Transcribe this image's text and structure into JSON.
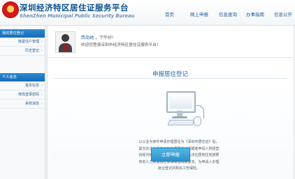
{
  "header": {
    "title_cn": "深圳经济特区居住证服务平台",
    "title_en": "ShenZhen Municipal Public Security Bureau",
    "nav": [
      "首页",
      "网上申报",
      "信息查询",
      "办事指南",
      "信息公开"
    ]
  },
  "sidebar": {
    "group1_title": "我的居住登记",
    "group1_items": [
      "房屋住户管理",
      "历史登记"
    ],
    "group2_title": "个人信息",
    "group2_items": [
      "基本信息",
      "修改登录密码",
      "系统消息"
    ]
  },
  "welcome": {
    "user_name": "西岛她",
    "greeting": "，下午好!",
    "message": "欢迎您登录深圳市经济特区居住证服务平台！"
  },
  "main": {
    "section_title": "申报居住登记",
    "notice": "以以业为条件申请办理居住为《深圳市居住证》后，需交办法证明单位持办理居住证明或者申请人所经营的经济组织的工商登记注册证明合法住居地住地按照劳务人力资源和社会保障局相关要求，为申请人办理就业登记并购买工伤保险。",
    "apply_button": "立即申报"
  },
  "colors": {
    "header_blue": "#0a4f8f",
    "sidebar_blue": "#176bb5",
    "button_blue": "#2d92cc"
  }
}
